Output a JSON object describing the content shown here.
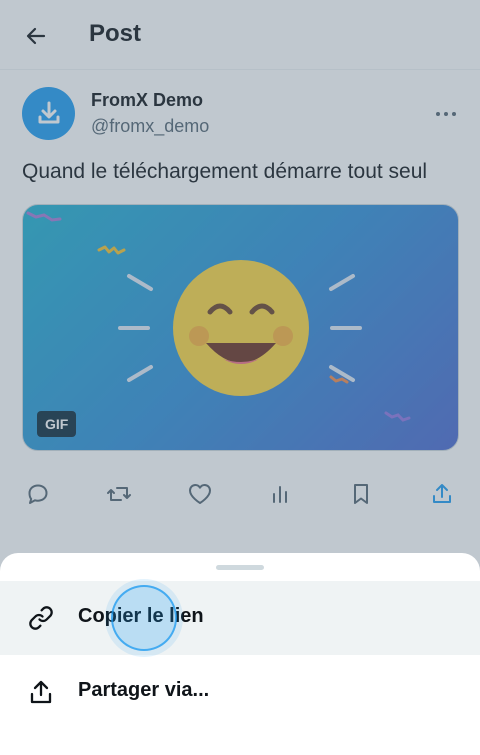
{
  "header": {
    "title": "Post",
    "back_icon": "arrow-left-icon"
  },
  "post": {
    "author_name": "FromX Demo",
    "author_handle": "@fromx_demo",
    "text": "Quand le téléchargement démarre tout seul",
    "media_badge": "GIF",
    "avatar_color": "#1d9bf0",
    "actions": [
      "reply-icon",
      "repost-icon",
      "like-icon",
      "views-icon",
      "bookmark-icon",
      "share-icon"
    ]
  },
  "share_sheet": {
    "items": [
      {
        "label": "Copier le lien",
        "icon": "link-icon"
      },
      {
        "label": "Partager via...",
        "icon": "share-icon"
      }
    ]
  },
  "colors": {
    "accent": "#1d9bf0",
    "text": "#0f1419",
    "muted": "#536471"
  }
}
